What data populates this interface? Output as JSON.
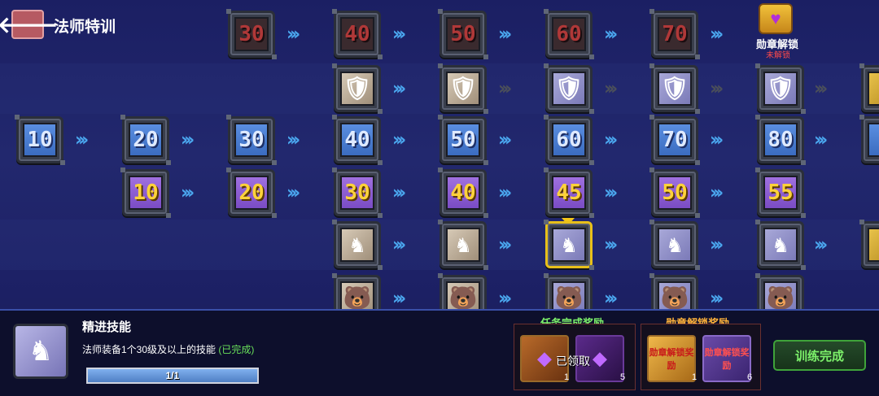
{
  "header": {
    "title": "法师特训",
    "back_icon": "arrow-left-icon"
  },
  "medal": {
    "label": "勋章解锁",
    "status": "未解锁"
  },
  "rows": {
    "dark_levels": [
      "30",
      "40",
      "50",
      "60",
      "70"
    ],
    "blue_levels": [
      "10",
      "20",
      "30",
      "40",
      "50",
      "60",
      "70",
      "80"
    ],
    "purple_levels": [
      "10",
      "20",
      "30",
      "40",
      "45",
      "50",
      "55"
    ]
  },
  "panel": {
    "skill_name": "精进技能",
    "skill_desc": "法师装备1个30级及以上的技能",
    "skill_status": "(已完成)",
    "progress_text": "1/1",
    "progress_fraction": 1.0,
    "task_reward_title": "任务完成奖励",
    "medal_reward_title": "勋章解锁奖励",
    "claimed_text": "已领取",
    "task_rewards": [
      {
        "name": "book-chest-icon",
        "count": "1"
      },
      {
        "name": "purple-gem-icon",
        "count": "5"
      }
    ],
    "medal_rewards": [
      {
        "label": "勋章解锁奖励",
        "count": "1"
      },
      {
        "label": "勋章解锁奖励",
        "count": "6"
      }
    ],
    "train_button": "训练完成"
  },
  "colors": {
    "accent_blue": "#4aa6ee",
    "gold": "#ffd23a",
    "done_green": "#69e05a",
    "locked_red": "#ff4a4a"
  }
}
